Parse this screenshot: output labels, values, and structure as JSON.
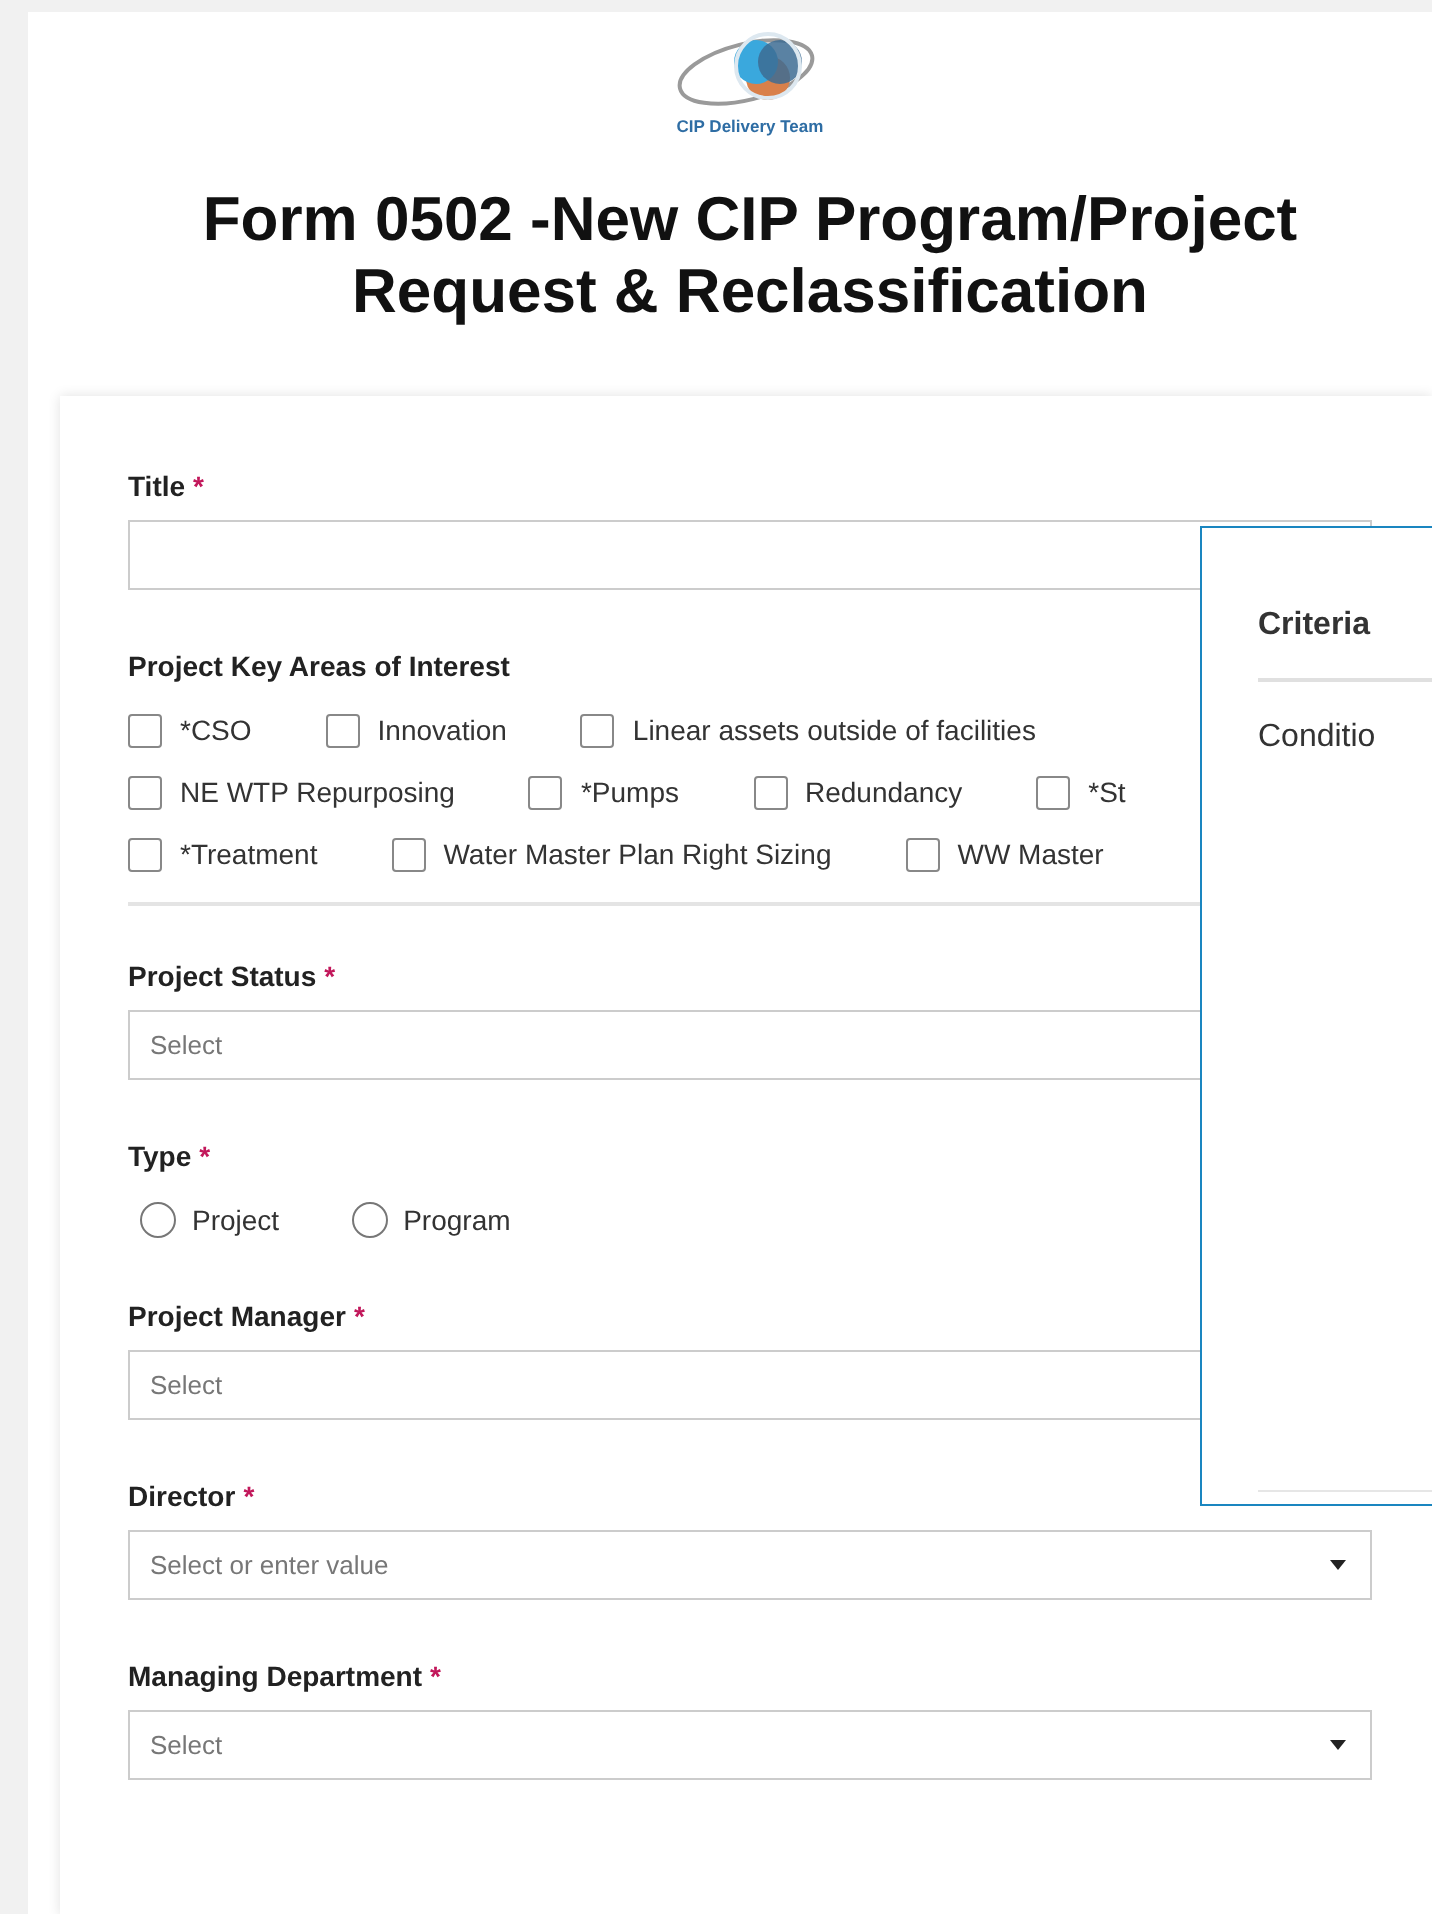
{
  "logo": {
    "caption": "CIP Delivery Team"
  },
  "form_title": "Form 0502 -New CIP Program/Project Request & Reclassification",
  "fields": [
    {
      "kind": "text",
      "label": "Title",
      "marker": "*"
    },
    {
      "kind": "checkboxes",
      "label": "Project Key Areas of Interest",
      "rows": [
        [
          {
            "label": "*CSO",
            "checked": false
          },
          {
            "label": "Innovation",
            "checked": false
          },
          {
            "label": "Linear assets outside of facilities",
            "checked": false
          }
        ],
        [
          {
            "label": "NE WTP Repurposing",
            "checked": false
          },
          {
            "label": "*Pumps",
            "checked": false
          },
          {
            "label": "Redundancy",
            "checked": false
          },
          {
            "label": "*St",
            "checked": false
          }
        ],
        [
          {
            "label": "*Treatment",
            "checked": false
          },
          {
            "label": "Water Master Plan Right Sizing",
            "checked": false
          },
          {
            "label": "WW Master",
            "checked": false
          }
        ]
      ]
    },
    {
      "kind": "divider"
    },
    {
      "kind": "select",
      "label": "Project Status",
      "marker": "*",
      "placeholder": "Select"
    },
    {
      "kind": "radio",
      "label": "Type",
      "marker": "*",
      "options": [
        {
          "label": "Project",
          "selected": false
        },
        {
          "label": "Program",
          "selected": false
        }
      ]
    },
    {
      "kind": "select",
      "label": "Project Manager",
      "marker": "*",
      "placeholder": "Select"
    },
    {
      "kind": "select",
      "label": "Director",
      "marker": "*",
      "placeholder": "Select or enter value"
    },
    {
      "kind": "select",
      "label": "Managing Department",
      "marker": "*",
      "placeholder": "Select"
    }
  ],
  "popup": {
    "header": "Criteria",
    "item": "Conditio"
  }
}
